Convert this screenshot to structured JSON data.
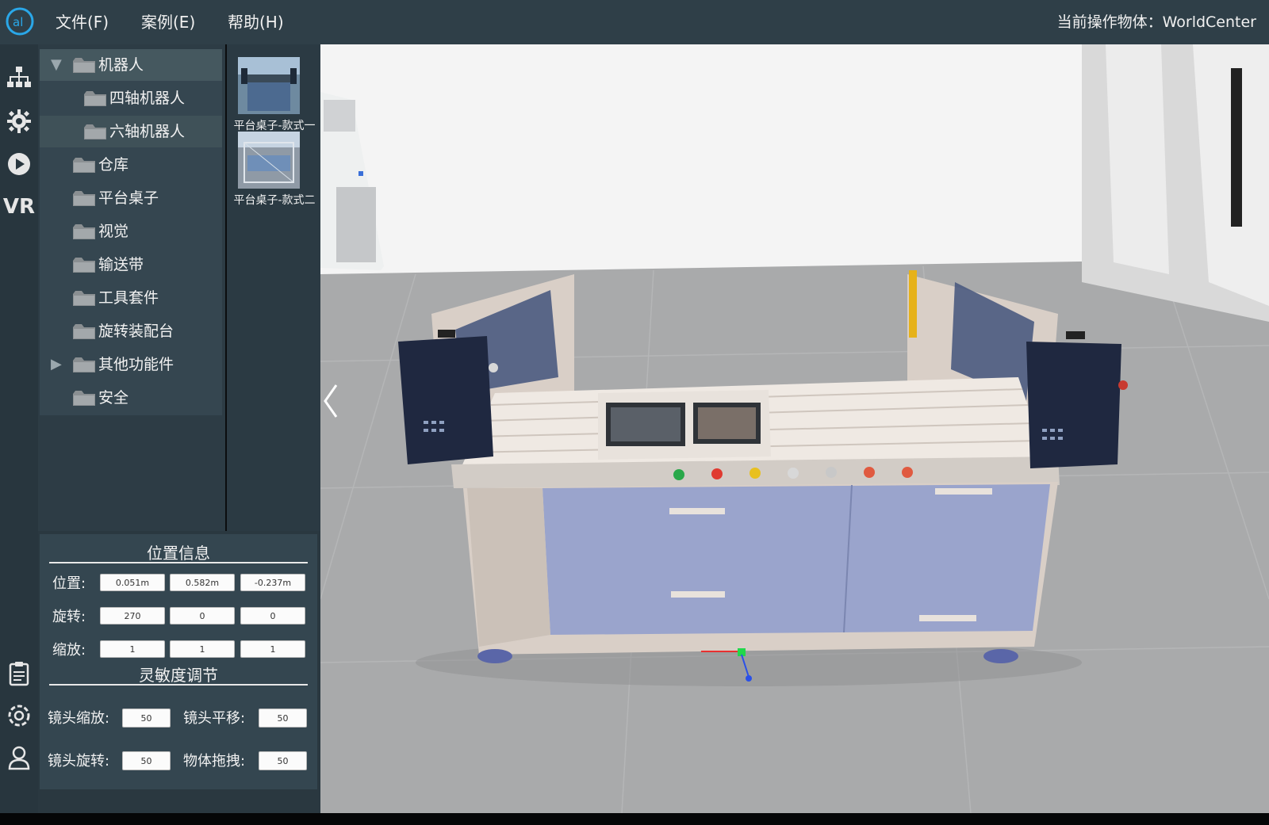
{
  "topbar": {
    "logo": "al",
    "menus": [
      {
        "label": "文件(F)"
      },
      {
        "label": "案例(E)"
      },
      {
        "label": "帮助(H)"
      }
    ],
    "status_label": "当前操作物体：",
    "status_value": "WorldCenter"
  },
  "rail": {
    "icons": [
      "hierarchy-icon",
      "gear-icon",
      "play-icon",
      "vr-icon",
      "clipboard-icon",
      "settings-ring-icon",
      "user-icon"
    ],
    "vr_label": "VR"
  },
  "tree": {
    "items": [
      {
        "label": "机器人",
        "arrow": "▼",
        "level": 0
      },
      {
        "label": "四轴机器人",
        "arrow": "",
        "level": 1
      },
      {
        "label": "六轴机器人",
        "arrow": "",
        "level": 1
      },
      {
        "label": "仓库",
        "arrow": "",
        "level": 0
      },
      {
        "label": "平台桌子",
        "arrow": "",
        "level": 0
      },
      {
        "label": "视觉",
        "arrow": "",
        "level": 0
      },
      {
        "label": "输送带",
        "arrow": "",
        "level": 0
      },
      {
        "label": "工具套件",
        "arrow": "",
        "level": 0
      },
      {
        "label": "旋转装配台",
        "arrow": "",
        "level": 0
      },
      {
        "label": "其他功能件",
        "arrow": "▶",
        "level": 0
      },
      {
        "label": "安全",
        "arrow": "",
        "level": 0
      }
    ]
  },
  "thumbnails": [
    {
      "label": "平台桌子-款式一"
    },
    {
      "label": "平台桌子-款式二"
    }
  ],
  "position_panel": {
    "title": "位置信息",
    "rows": [
      {
        "label": "位置:",
        "values": [
          "0.051m",
          "0.582m",
          "-0.237m"
        ]
      },
      {
        "label": "旋转:",
        "values": [
          "270",
          "0",
          "0"
        ]
      },
      {
        "label": "缩放:",
        "values": [
          "1",
          "1",
          "1"
        ]
      }
    ]
  },
  "sensitivity_panel": {
    "title": "灵敏度调节",
    "fields": [
      {
        "label": "镜头缩放:",
        "value": "50"
      },
      {
        "label": "镜头平移:",
        "value": "50"
      },
      {
        "label": "镜头旋转:",
        "value": "50"
      },
      {
        "label": "物体拖拽:",
        "value": "50"
      }
    ]
  },
  "colors": {
    "topbar": "#2f3f48",
    "panel": "#354650",
    "accent_logo": "#2aa7e8",
    "floor": "#a9aaab",
    "wall": "#f4f4f4"
  }
}
